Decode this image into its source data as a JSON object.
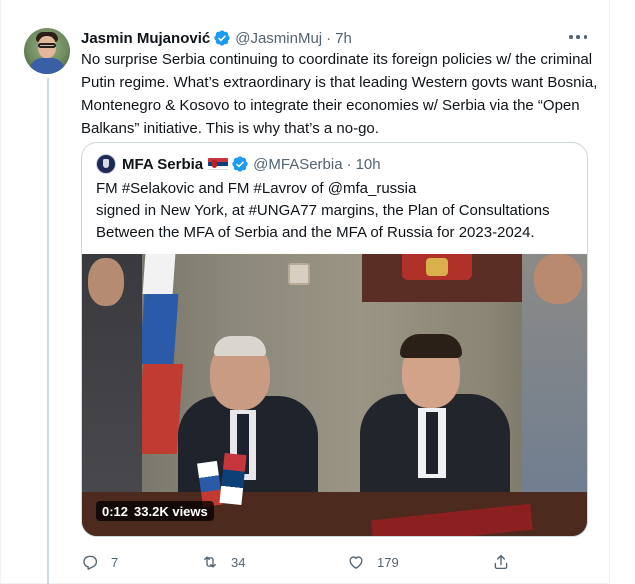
{
  "tweet": {
    "author_name": "Jasmin Mujanović",
    "author_handle": "@JasminMuj",
    "separator": "·",
    "timestamp": "7h",
    "verified": true,
    "text": "No surprise Serbia continuing to coordinate its foreign policies w/ the criminal Putin regime. What’s extraordinary is that leading Western govts want Bosnia, Montenegro & Kosovo to integrate their economies w/ Serbia via the “Open Balkans” initiative. This is why that’s a no-go.",
    "more_icon": "more-horizontal-icon"
  },
  "quoted_tweet": {
    "author_name": "MFA Serbia",
    "author_flag": "serbian-flag-emoji",
    "verified": true,
    "author_handle": "@MFASerbia",
    "separator": "·",
    "timestamp": "10h",
    "text_lines": [
      "FM #Selakovic and FM #Lavrov of @mfa_russia",
      "signed in New York, at #UNGA77 margins, the Plan of Consultations",
      "Between the MFA of Serbia and the MFA of Russia for 2023-2024."
    ],
    "video": {
      "duration": "0:12",
      "views": "33.2K views"
    }
  },
  "actions": {
    "reply": {
      "icon": "reply-icon",
      "count": "7"
    },
    "retweet": {
      "icon": "retweet-icon",
      "count": "34"
    },
    "like": {
      "icon": "heart-icon",
      "count": "179"
    },
    "share": {
      "icon": "share-icon"
    }
  },
  "colors": {
    "text_primary": "#0f1419",
    "text_secondary": "#536471",
    "verified_blue": "#1d9bf0",
    "border": "#cfd9de"
  }
}
